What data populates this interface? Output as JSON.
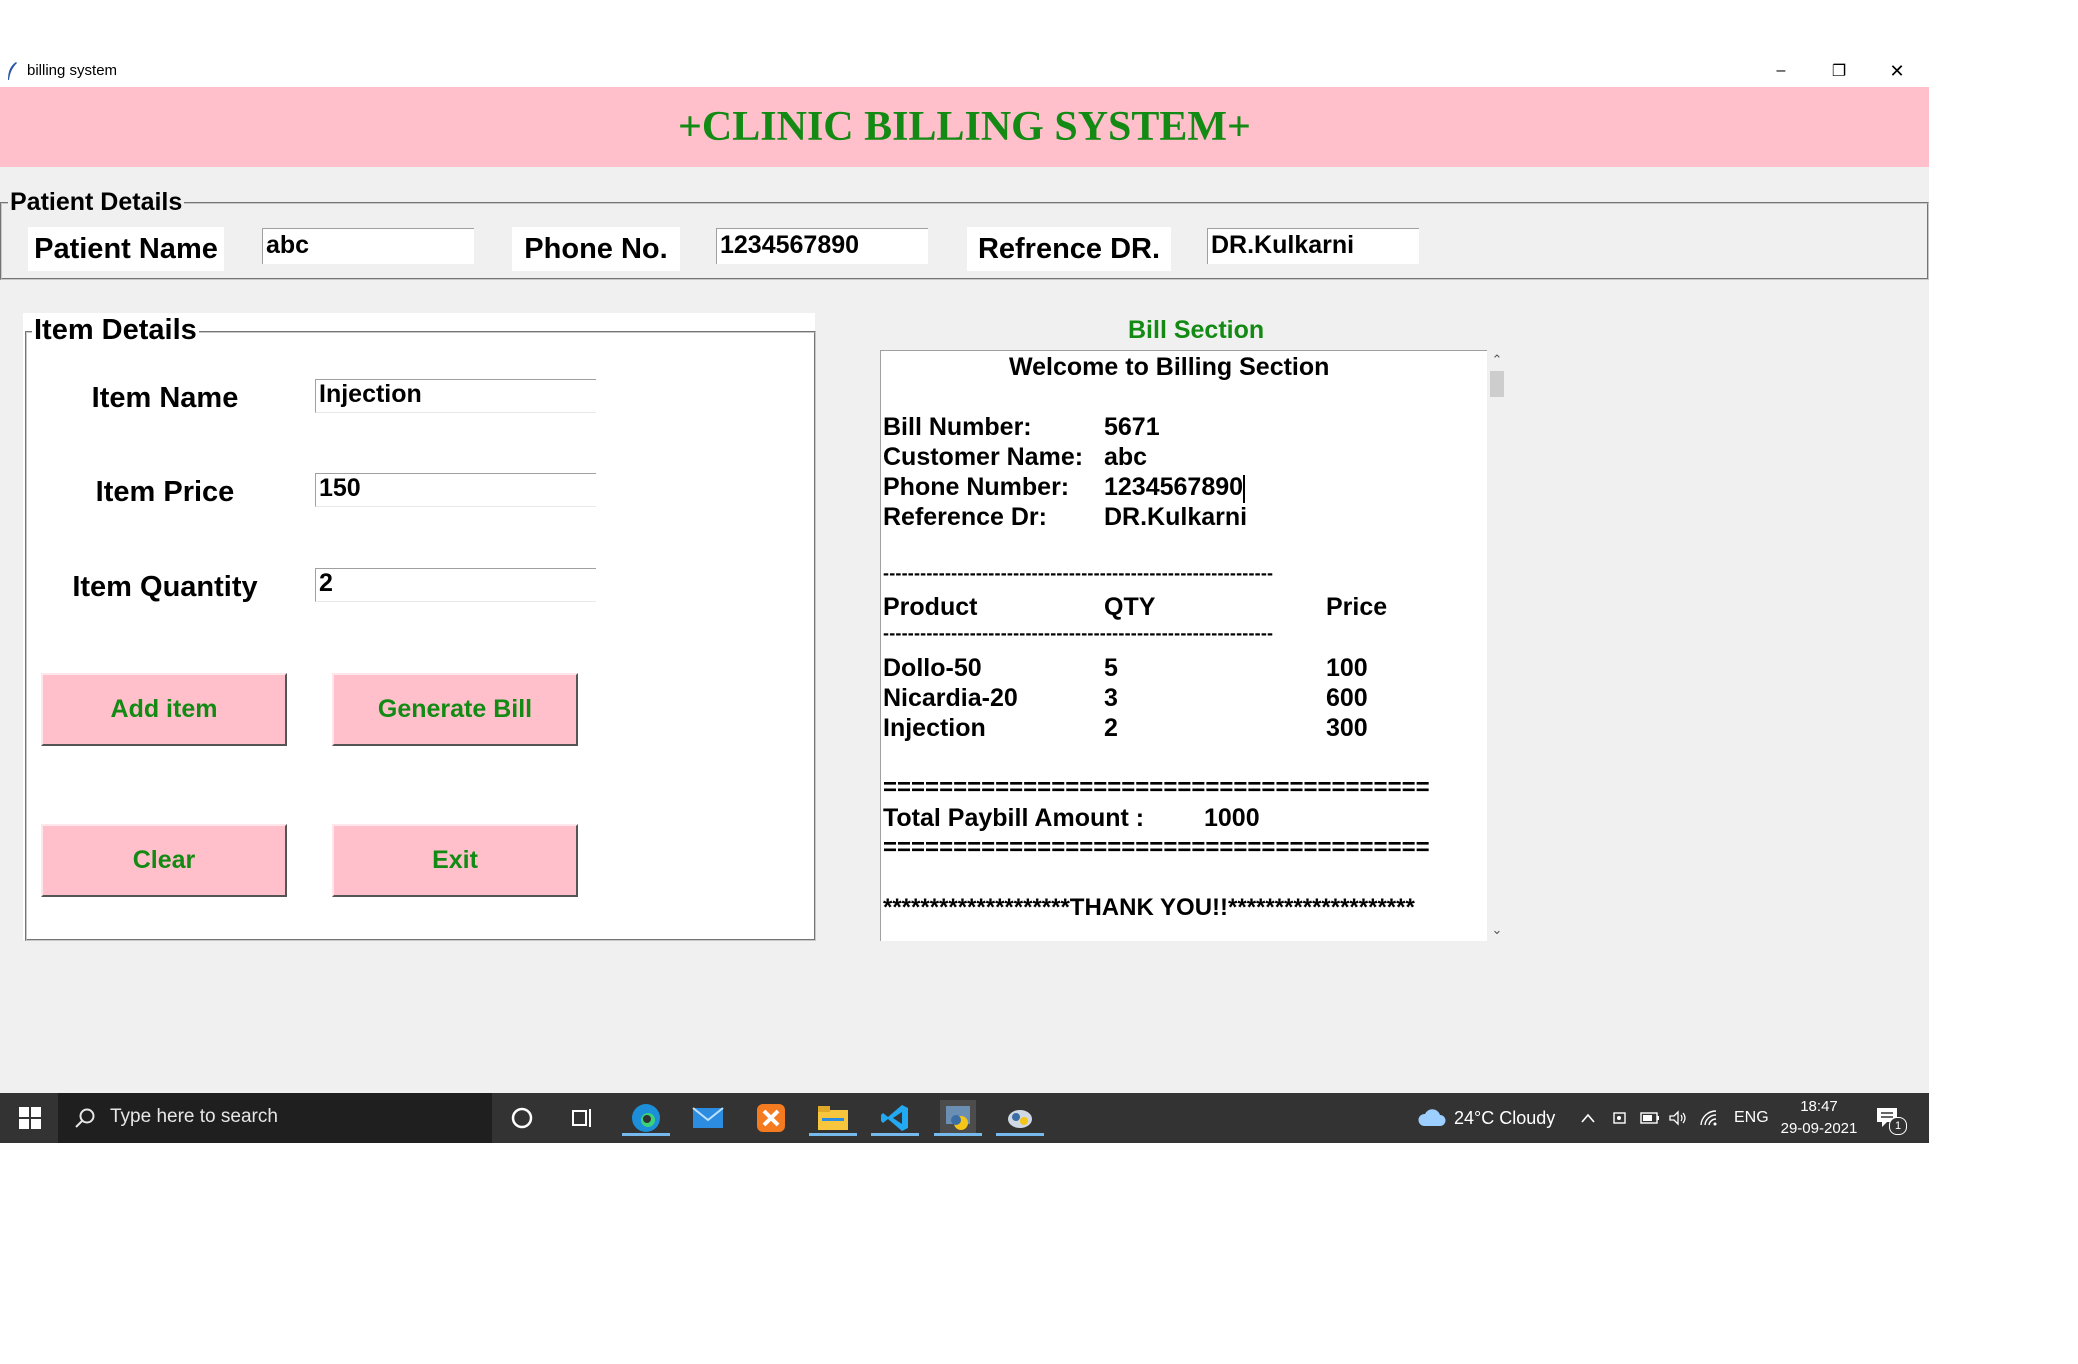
{
  "window": {
    "title": "billing system",
    "minimize_glyph": "–",
    "maximize_glyph": "❐",
    "close_glyph": "✕",
    "icon": "feather-icon"
  },
  "header": {
    "title": "+CLINIC BILLING SYSTEM+"
  },
  "patient": {
    "legend": "Patient Details",
    "name_label": "Patient Name",
    "name_value": "abc",
    "phone_label": "Phone No.",
    "phone_value": "1234567890",
    "doctor_label": "Refrence DR.",
    "doctor_value": "DR.Kulkarni"
  },
  "items": {
    "legend": "Item Details",
    "name_label": "Item Name",
    "name_value": "Injection",
    "price_label": "Item Price",
    "price_value": "150",
    "qty_label": "Item Quantity",
    "qty_value": "2",
    "buttons": {
      "add": "Add item",
      "generate": "Generate Bill",
      "clear": "Clear",
      "exit": "Exit"
    }
  },
  "bill": {
    "section_title": "Bill Section",
    "welcome": "Welcome to Billing Section",
    "bill_number_label": "Bill Number:",
    "bill_number": "5671",
    "customer_label": "Customer Name:",
    "customer": "abc",
    "phone_label": "Phone Number:",
    "phone": "1234567890",
    "doctor_label": "Reference Dr:",
    "doctor": "DR.Kulkarni",
    "dash_line": "---------------------------------------------------------------",
    "columns": [
      "Product",
      "QTY",
      "Price"
    ],
    "rows": [
      [
        "Dollo-50",
        "5",
        "100"
      ],
      [
        "Nicardia-20",
        "3",
        "600"
      ],
      [
        "Injection",
        "2",
        "300"
      ]
    ],
    "eq_line": "=======================================",
    "total_label": "Total Paybill Amount :",
    "total": "1000",
    "thanks": "********************THANK YOU!!********************"
  },
  "taskbar": {
    "search_placeholder": "Type here to search",
    "weather": "24°C  Cloudy",
    "lang": "ENG",
    "time": "18:47",
    "date": "29-09-2021",
    "notification_count": "1",
    "colors": {
      "bar": "#333333",
      "accent": "#76b9ed"
    }
  },
  "colors": {
    "header_bg": "#ffc0cb",
    "title_green": "#138a13",
    "button_bg": "#ffc0cb"
  }
}
